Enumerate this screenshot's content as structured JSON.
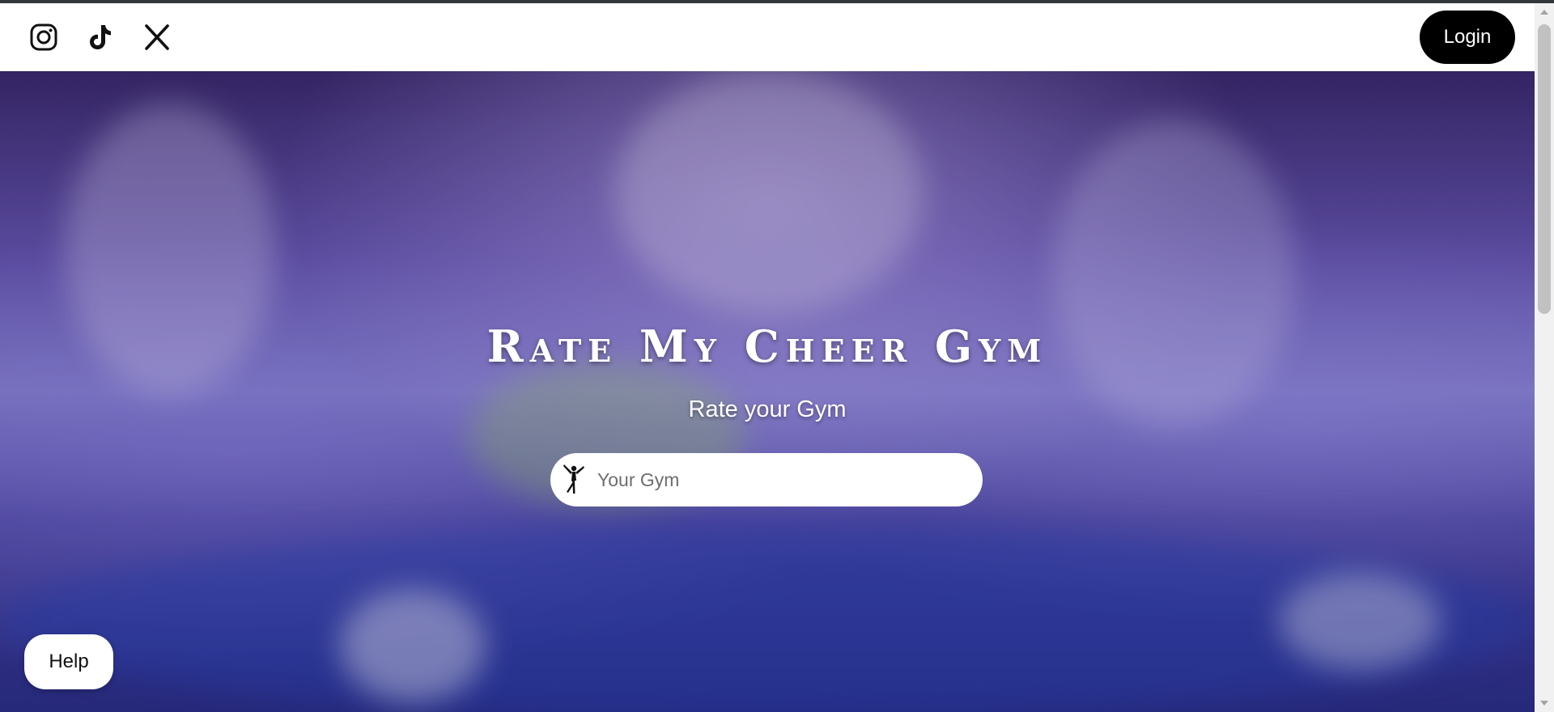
{
  "navbar": {
    "social": [
      {
        "name": "instagram",
        "icon": "instagram-icon"
      },
      {
        "name": "tiktok",
        "icon": "tiktok-icon"
      },
      {
        "name": "x",
        "icon": "x-icon"
      }
    ],
    "login_label": "Login"
  },
  "hero": {
    "title": "Rate My Cheer Gym",
    "subtitle": "Rate your Gym",
    "background_desc_colors": [
      "#3b2a6e",
      "#8a86d8",
      "#2a2f8a"
    ]
  },
  "search": {
    "icon": "cheerleader-icon",
    "placeholder": "Your Gym",
    "value": ""
  },
  "help": {
    "label": "Help"
  },
  "colors": {
    "login_bg": "#000000",
    "help_bg": "#ffffff"
  }
}
